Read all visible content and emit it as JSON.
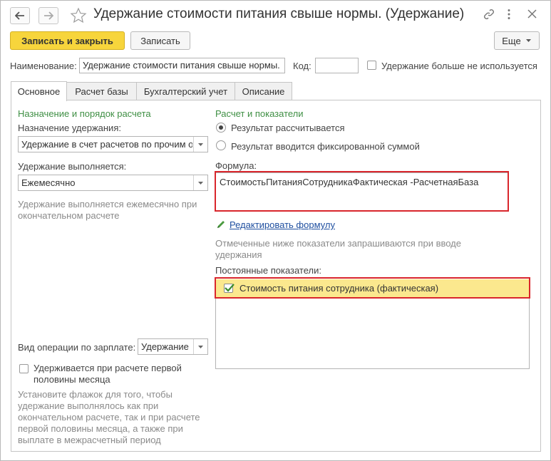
{
  "window": {
    "title": "Удержание стоимости питания свыше нормы. (Удержание)",
    "icons": [
      "arrow-left-icon",
      "arrow-right-icon",
      "star-icon",
      "link-icon",
      "more-icon",
      "close-icon"
    ]
  },
  "toolbar": {
    "save_close_label": "Записать и закрыть",
    "save_label": "Записать",
    "more_label": "Еще"
  },
  "header": {
    "name_label": "Наименование:",
    "name_value": "Удержание стоимости питания свыше нормы.",
    "code_label": "Код:",
    "code_value": "",
    "unused_label": "Удержание больше не используется"
  },
  "tabs": [
    {
      "label": "Основное",
      "active": true
    },
    {
      "label": "Расчет базы",
      "active": false
    },
    {
      "label": "Бухгалтерский учет",
      "active": false
    },
    {
      "label": "Описание",
      "active": false
    }
  ],
  "left": {
    "section_title": "Назначение и порядок расчета",
    "purpose_label": "Назначение удержания:",
    "purpose_value": "Удержание в счет расчетов по прочим операциям",
    "performed_label": "Удержание выполняется:",
    "performed_value": "Ежемесячно",
    "performed_hint": "Удержание выполняется ежемесячно при окончательном расчете",
    "operation_label": "Вид операции по зарплате:",
    "operation_value": "Удержание",
    "first_half_label_1": "Удерживается при расчете первой",
    "first_half_label_2": "половины месяца",
    "first_half_hint": "Установите флажок для того, чтобы удержание выполнялось как при окончательном расчете, так и при расчете первой половины месяца, а также при выплате в межрасчетный период"
  },
  "right": {
    "section_title": "Расчет и показатели",
    "radio_calculated": "Результат рассчитывается",
    "radio_fixed": "Результат вводится фиксированной суммой",
    "formula_label": "Формула:",
    "formula_value": "СтоимостьПитанияСотрудникаФактическая -РасчетнаяБаза",
    "edit_formula_link": "Редактировать формулу",
    "indicators_hint": "Отмеченные ниже показатели запрашиваются при вводе удержания",
    "constant_label": "Постоянные показатели:",
    "constant_items": [
      {
        "label": "Стоимость питания сотрудника (фактическая)",
        "checked": true
      }
    ]
  },
  "colors": {
    "primary_button": "#f7d53c",
    "highlight_row": "#fbe88e",
    "accent_green": "#3f8f44",
    "hint_gray": "#8a8a8a",
    "red_outline": "#d9262c",
    "link_blue": "#1f4fa0"
  }
}
